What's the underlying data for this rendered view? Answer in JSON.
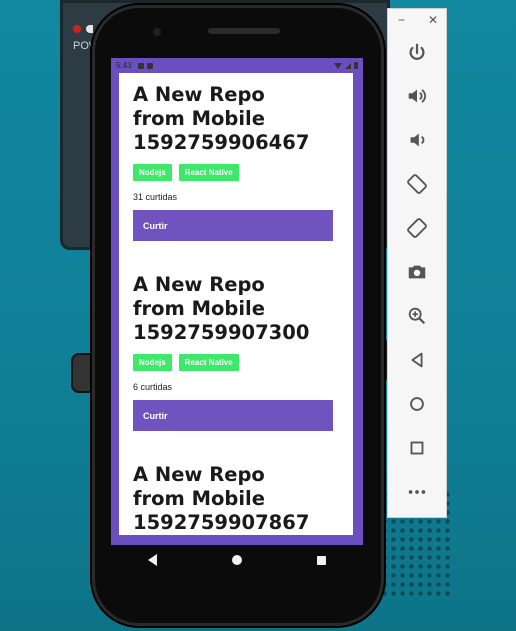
{
  "background": {
    "power_label": "POW"
  },
  "status_bar": {
    "time": "5:43"
  },
  "repos": [
    {
      "title": "A New Repo\nfrom  Mobile\n1592759906467",
      "techs": [
        "Nodejs",
        "React Native"
      ],
      "likes": "31 curtidas",
      "like_button": "Curtir"
    },
    {
      "title": "A New Repo\nfrom  Mobile\n1592759907300",
      "techs": [
        "Nodejs",
        "React Native"
      ],
      "likes": "6 curtidas",
      "like_button": "Curtir"
    },
    {
      "title": "A New Repo\nfrom  Mobile\n1592759907867"
    }
  ],
  "toolbar": {
    "minimize": "−",
    "close": "✕",
    "items": [
      {
        "icon": "power-icon"
      },
      {
        "icon": "volume-up-icon"
      },
      {
        "icon": "volume-down-icon"
      },
      {
        "icon": "rotate-left-icon"
      },
      {
        "icon": "rotate-right-icon"
      },
      {
        "icon": "camera-icon"
      },
      {
        "icon": "zoom-icon"
      },
      {
        "icon": "back-icon"
      },
      {
        "icon": "home-icon"
      },
      {
        "icon": "overview-icon"
      },
      {
        "icon": "more-icon"
      }
    ]
  },
  "colors": {
    "accent": "#7153c0",
    "tech_badge": "#3ee86a",
    "screen_frame": "#6b4fc0"
  }
}
